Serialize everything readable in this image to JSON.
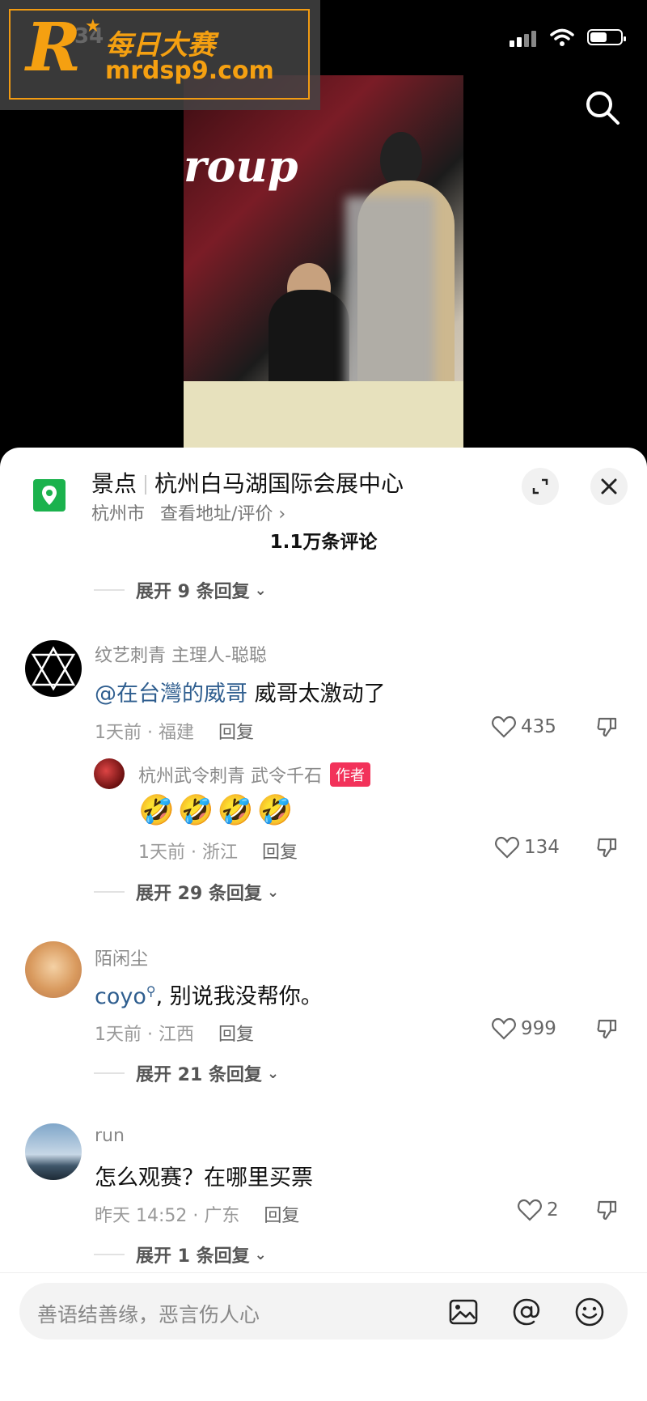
{
  "status_bar": {
    "time": "34"
  },
  "watermark": {
    "logo": "R",
    "title": "每日大赛",
    "url": "mrdsp9.com"
  },
  "video": {
    "overlay_text": "roup"
  },
  "location": {
    "category": "景点",
    "name": "杭州白马湖国际会展中心",
    "city": "杭州市",
    "link": "查看地址/评价 ›"
  },
  "comments_header": {
    "count": "1.1万条评论"
  },
  "threads": [
    {
      "expand": "展开 9 条回复"
    },
    {
      "username": "纹艺刺青  主理人-聪聪",
      "mention": "@在台灣的威哥",
      "text": " 威哥太激动了",
      "time_loc": "1天前 · 福建",
      "reply": "回复",
      "likes": "435",
      "sub_reply": {
        "username": "杭州武令刺青 武令千石",
        "badge": "作者",
        "text": "🤣🤣🤣🤣",
        "time_loc": "1天前 · 浙江",
        "reply": "回复",
        "likes": "134"
      },
      "expand": "展开 29 条回复"
    },
    {
      "username": "陌闲尘",
      "mention": "coyo",
      "text": ", 别说我没帮你。",
      "time_loc": "1天前 · 江西",
      "reply": "回复",
      "likes": "999",
      "expand": "展开 21 条回复"
    },
    {
      "username": "run",
      "text": "怎么观赛？在哪里买票",
      "time_loc": "昨天 14:52 · 广东",
      "reply": "回复",
      "likes": "2",
      "expand": "展开 1 条回复"
    }
  ],
  "input": {
    "placeholder": "善语结善缘，恶言伤人心"
  }
}
